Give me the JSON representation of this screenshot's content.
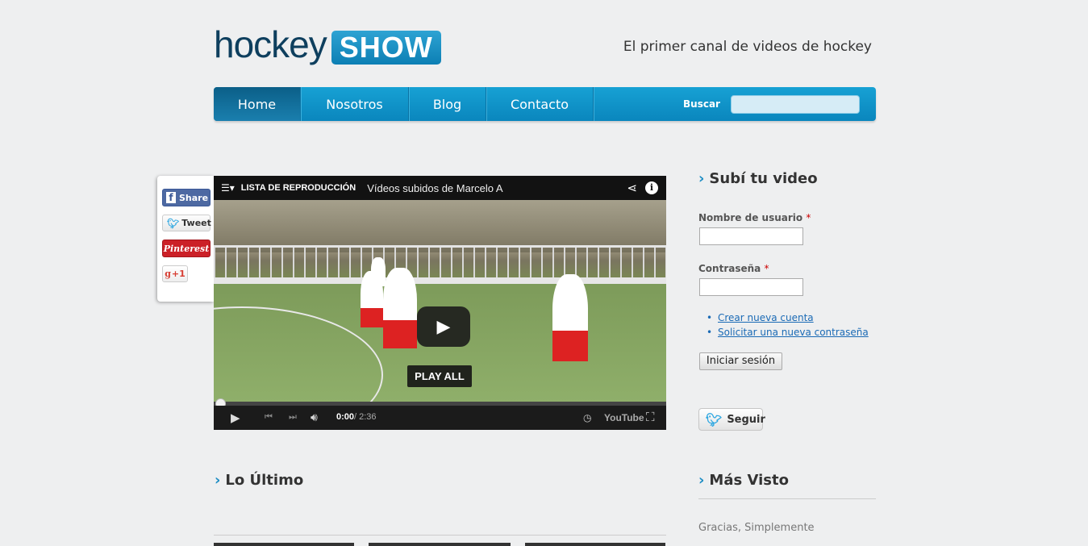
{
  "header": {
    "logo_word1": "hockey",
    "logo_word2": "SHOW",
    "tagline": "El primer canal de videos de hockey"
  },
  "nav": {
    "items": [
      "Home",
      "Nosotros",
      "Blog",
      "Contacto"
    ],
    "active": "Home",
    "search_label": "Buscar",
    "search_value": ""
  },
  "social": {
    "facebook": "Share",
    "twitter": "Tweet",
    "pinterest": "Pinterest",
    "gplus": "+1"
  },
  "video": {
    "playlist_label": "LISTA DE REPRODUCCIÓN",
    "title": "Vídeos subidos de Marcelo A",
    "play_all": "PLAY ALL",
    "time_current": "0:00",
    "time_total": "/ 2:36",
    "brand": "YouTube",
    "progress": 0
  },
  "login": {
    "heading": "Subí tu video",
    "username_label": "Nombre de usuario",
    "password_label": "Contraseña",
    "required_mark": "*",
    "links": [
      "Crear nueva cuenta",
      "Solicitar una nueva contraseña"
    ],
    "submit": "Iniciar sesión"
  },
  "twitter_follow": "Seguir",
  "sections": {
    "latest": "Lo Último",
    "most_viewed": "Más Visto",
    "most_viewed_first": "Gracias, Simplemente"
  },
  "colors": {
    "accent": "#0a86bd",
    "logo_dark": "#0e3f5e",
    "background": "#eeeff0"
  }
}
